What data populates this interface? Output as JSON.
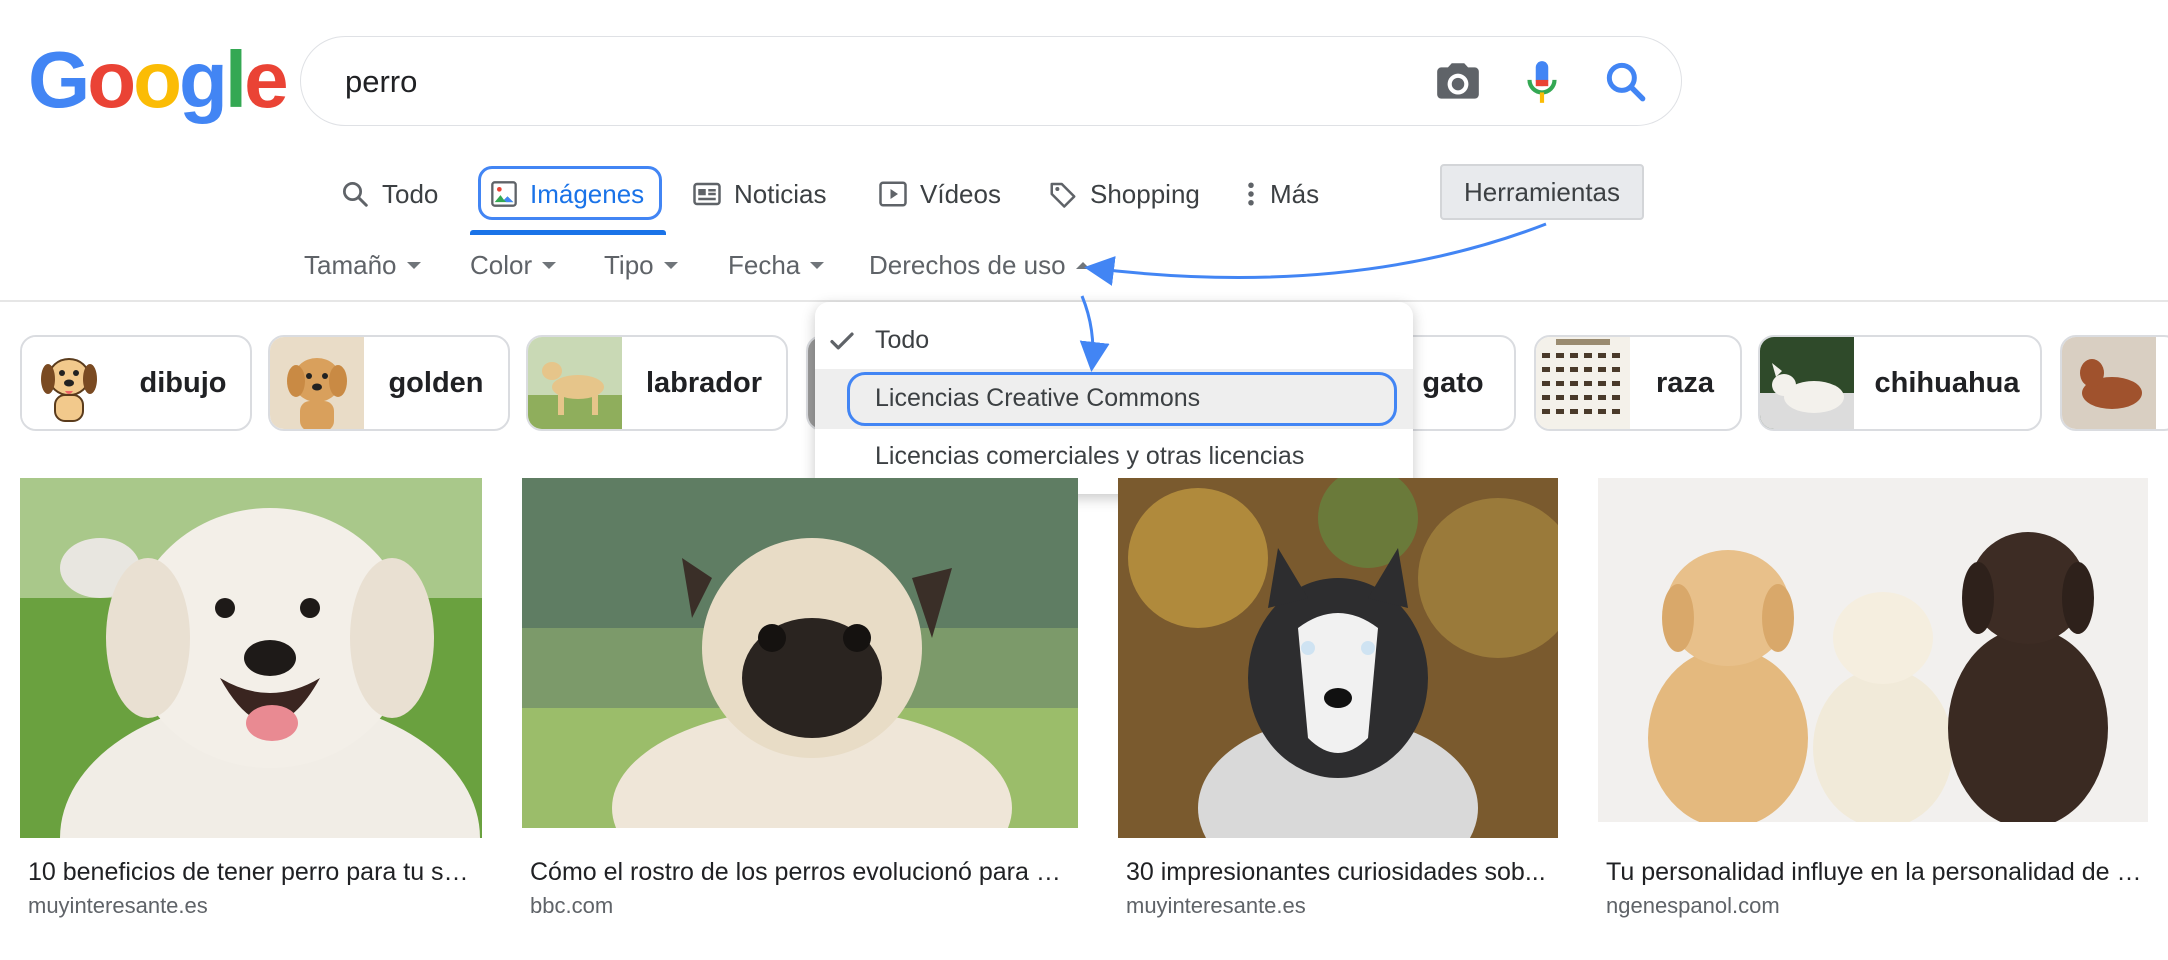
{
  "logo": {
    "letters": [
      "G",
      "o",
      "o",
      "g",
      "l",
      "e"
    ],
    "colors": [
      "#4285F4",
      "#EA4335",
      "#FBBC05",
      "#4285F4",
      "#34A853",
      "#EA4335"
    ]
  },
  "search": {
    "query": "perro",
    "camera_icon": "camera-icon",
    "mic_icon": "microphone-icon",
    "search_icon": "search-icon"
  },
  "tabs": [
    {
      "label": "Todo",
      "icon": "search-icon"
    },
    {
      "label": "Imágenes",
      "icon": "image-icon",
      "active": true
    },
    {
      "label": "Noticias",
      "icon": "news-icon"
    },
    {
      "label": "Vídeos",
      "icon": "play-icon"
    },
    {
      "label": "Shopping",
      "icon": "tag-icon"
    },
    {
      "label": "Más",
      "icon": "more-vert-icon"
    }
  ],
  "tools": {
    "label": "Herramientas"
  },
  "filters": [
    "Tamaño",
    "Color",
    "Tipo",
    "Fecha",
    "Derechos de uso"
  ],
  "chips": [
    {
      "label": "dibujo"
    },
    {
      "label": "golden"
    },
    {
      "label": "labrador"
    },
    {
      "label": "gato"
    },
    {
      "label": "raza"
    },
    {
      "label": "chihuahua"
    }
  ],
  "dropdown": {
    "items": [
      "Todo",
      "Licencias Creative Commons",
      "Licencias comerciales y otras licencias"
    ],
    "selected": "Todo",
    "highlighted": "Licencias Creative Commons"
  },
  "results": [
    {
      "title": "10 beneficios de tener perro para tu sa...",
      "source": "muyinteresante.es"
    },
    {
      "title": "Cómo el rostro de los perros evolucionó para e...",
      "source": "bbc.com"
    },
    {
      "title": "30 impresionantes curiosidades sob...",
      "source": "muyinteresante.es"
    },
    {
      "title": "Tu personalidad influye en la personalidad de t...",
      "source": "ngenespanol.com"
    }
  ],
  "colors": {
    "accent": "#1a73e8",
    "annotation": "#4285f4"
  }
}
